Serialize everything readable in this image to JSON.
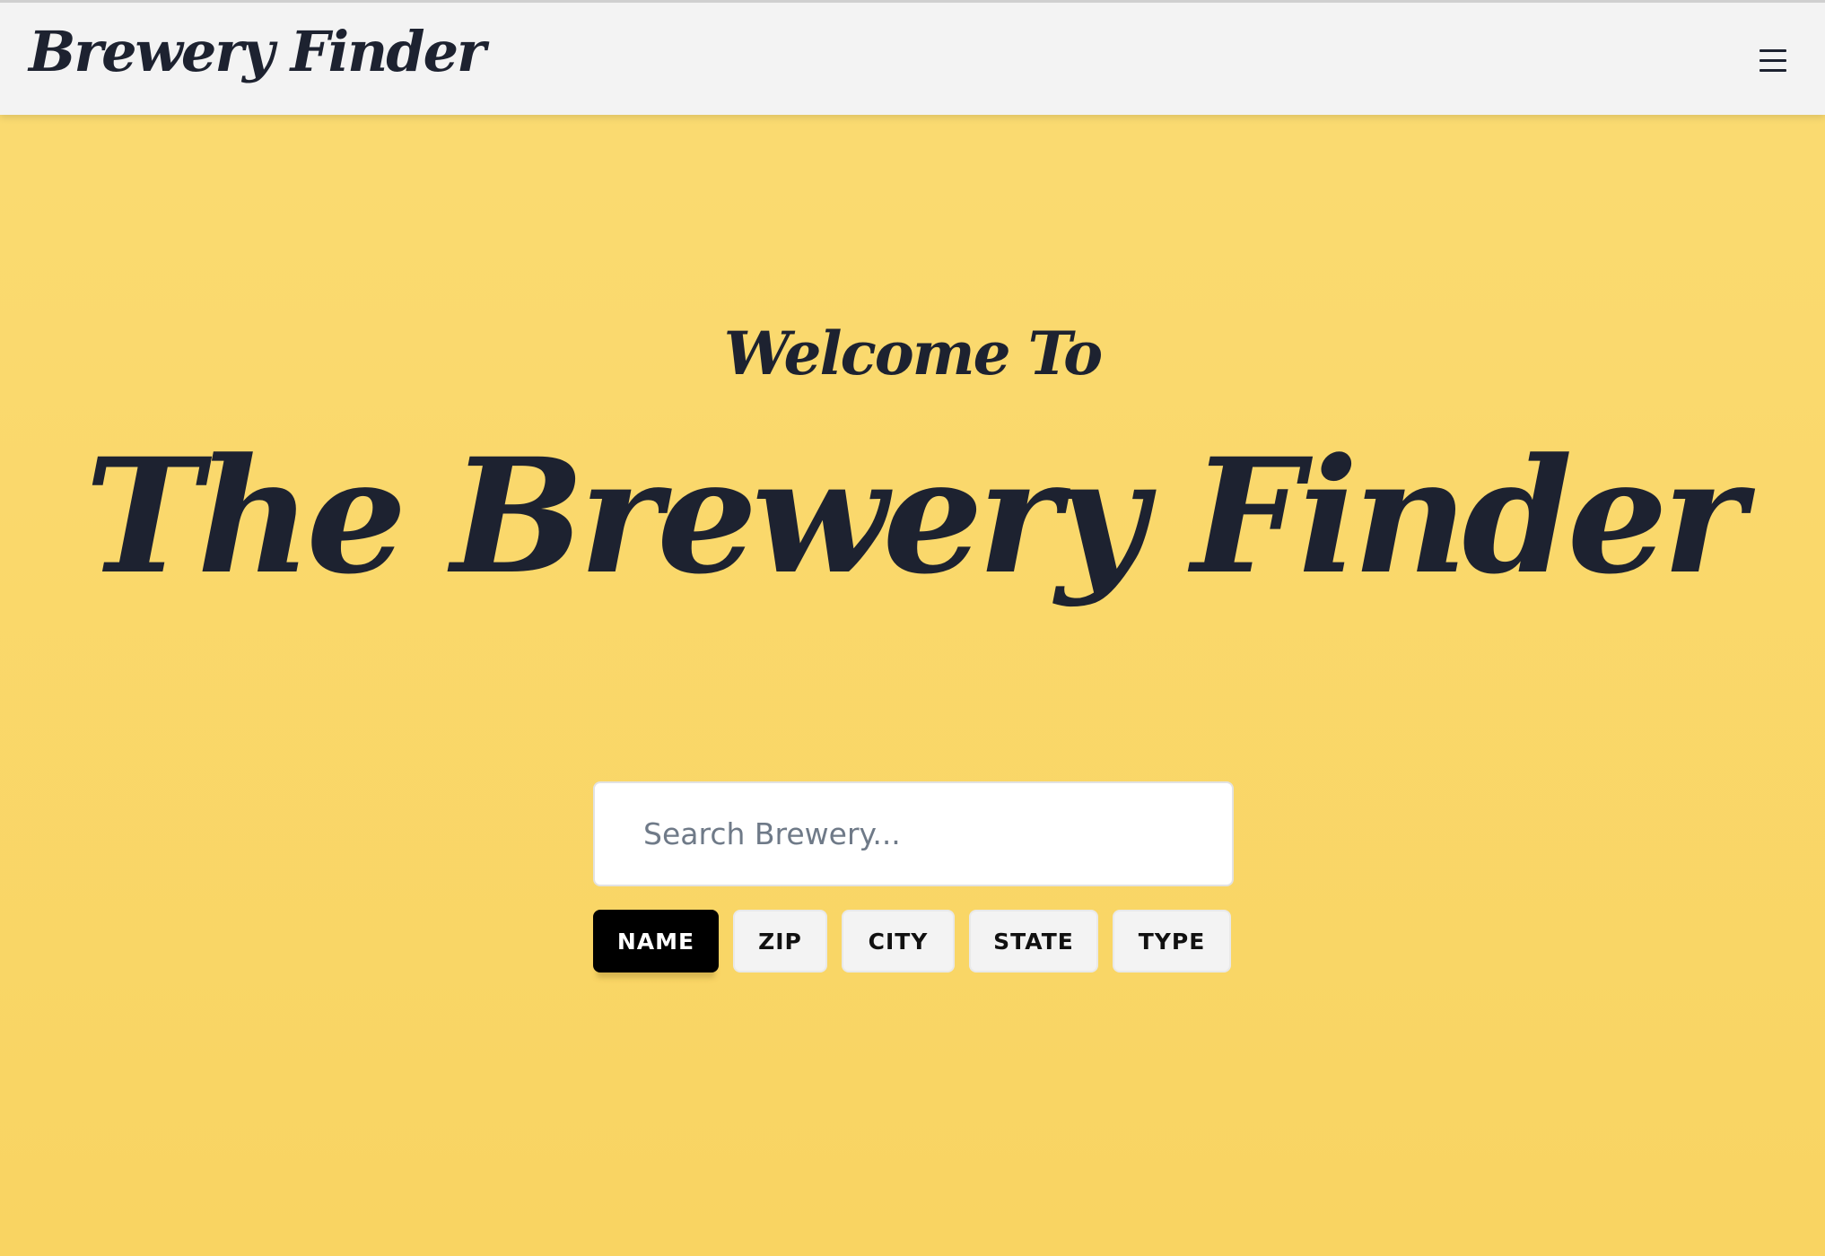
{
  "header": {
    "brand": "Brewery Finder",
    "menu_icon": "hamburger-menu-icon"
  },
  "hero": {
    "welcome": "Welcome To",
    "title": "The Brewery Finder"
  },
  "search": {
    "placeholder": "Search Brewery...",
    "value": ""
  },
  "filters": {
    "active": "NAME",
    "items": [
      {
        "label": "NAME"
      },
      {
        "label": "ZIP"
      },
      {
        "label": "CITY"
      },
      {
        "label": "STATE"
      },
      {
        "label": "TYPE"
      }
    ]
  },
  "colors": {
    "background": "#fadb72",
    "header_bg": "#f3f3f3",
    "text_dark": "#1d2230",
    "active_filter_bg": "#000000"
  }
}
